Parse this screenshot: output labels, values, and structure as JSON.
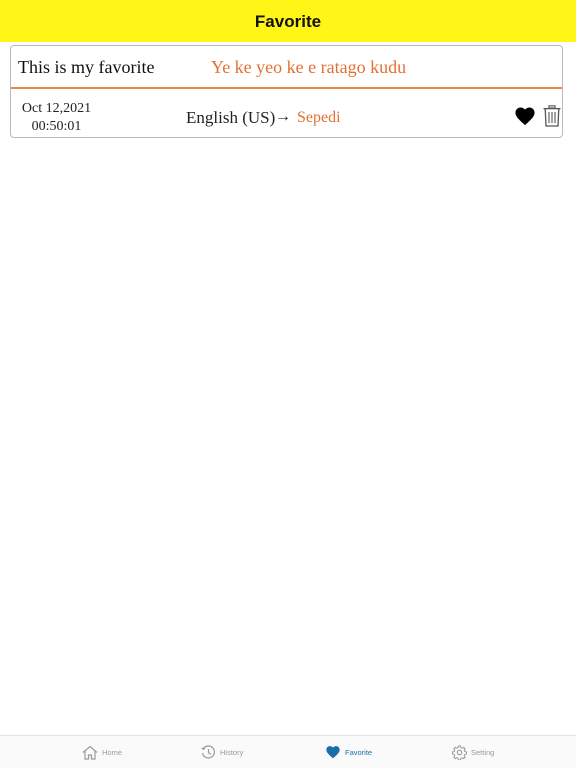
{
  "nav": {
    "title": "Favorite"
  },
  "favorites": [
    {
      "source_text": "This is my favorite",
      "translated_text": "Ye ke yeo ke e ratago kudu",
      "date": "Oct 12,2021",
      "time": "00:50:01",
      "from_language": "English (US)",
      "arrow": "→",
      "to_language": "Sepedi",
      "favorite_icon": "heart-filled-icon",
      "delete_icon": "trash-icon"
    }
  ],
  "tabs": [
    {
      "label": "Home",
      "icon": "house-icon",
      "active": false
    },
    {
      "label": "History",
      "icon": "clock-history-icon",
      "active": false
    },
    {
      "label": "Favorite",
      "icon": "heart-icon",
      "active": true
    },
    {
      "label": "Setting",
      "icon": "gear-icon",
      "active": false
    }
  ],
  "colors": {
    "nav_background": "#fff516",
    "translated_text": "#e46f33",
    "divider": "#e8874f",
    "tab_active": "#1a6fa8",
    "tab_inactive": "#9a9a9a"
  }
}
